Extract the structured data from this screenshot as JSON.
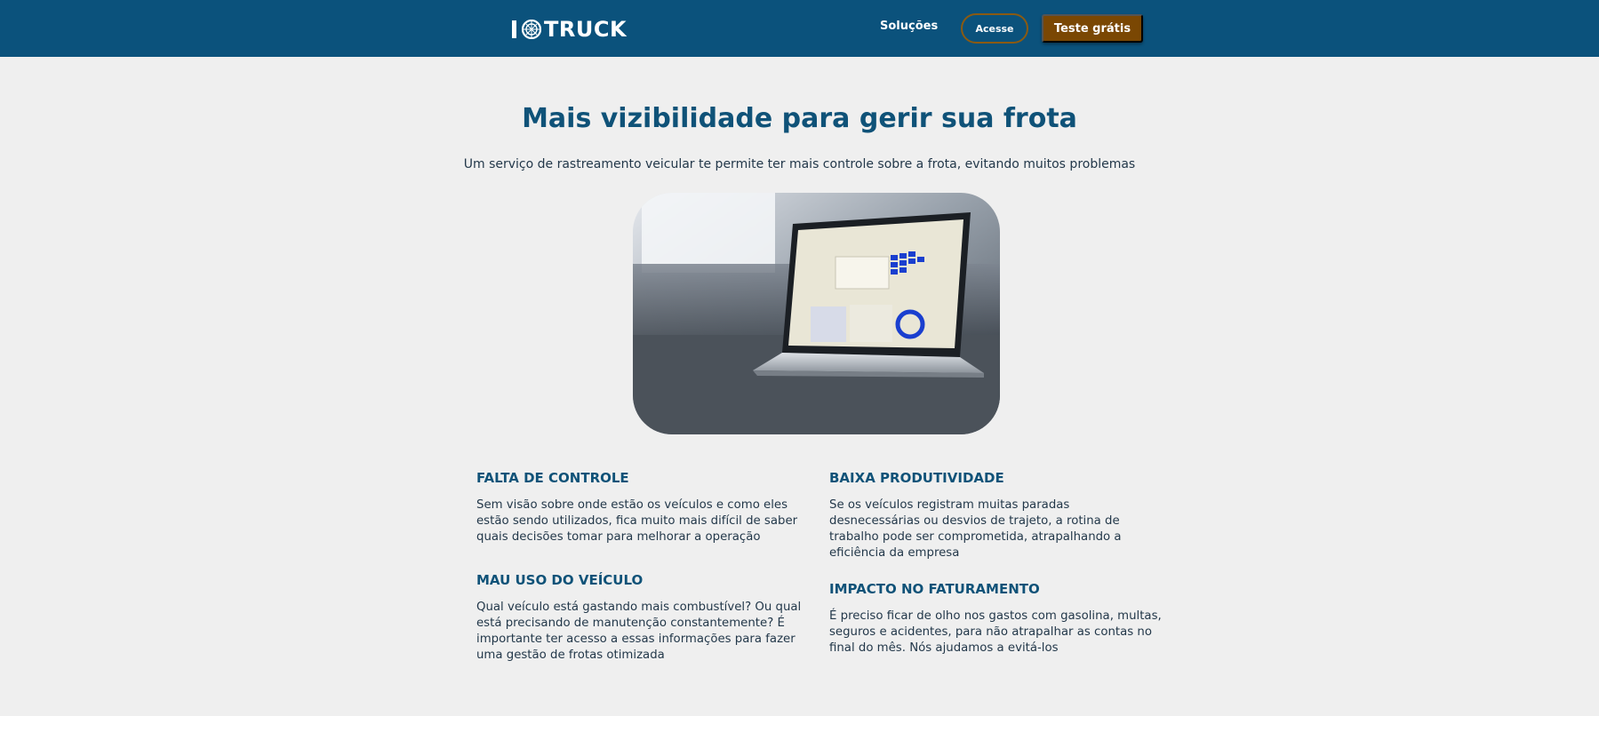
{
  "header": {
    "logo_text": "TRUCK",
    "logo_prefix": "I",
    "nav_solucoes": "Soluções",
    "btn_acesse": "Acesse",
    "btn_teste": "Teste grátis",
    "colors": {
      "bar": "#0b527c",
      "accent": "#7a4703"
    }
  },
  "main": {
    "title": "Mais vizibilidade para gerir sua frota",
    "subtitle": "Um serviço de rastreamento veicular te permite ter mais controle sobre a frota, evitando muitos problemas",
    "hero_image": "laptop-dashboard-photo",
    "features": [
      {
        "heading": "FALTA DE CONTROLE",
        "text": "Sem visão sobre onde estão os veículos e como eles estão sendo utilizados, fica muito mais difícil de saber quais decisões tomar para melhorar a operação"
      },
      {
        "heading": "BAIXA PRODUTIVIDADE",
        "text": "Se os veículos registram muitas paradas desnecessárias ou desvios de trajeto, a rotina de trabalho pode ser comprometida, atrapalhando a eficiência da empresa"
      },
      {
        "heading": "MAU USO DO VEÍCULO",
        "text": "Qual veículo está gastando mais combustível? Ou qual está precisando de manutenção constantemente? É importante ter acesso a essas informações para fazer uma gestão de frotas otimizada"
      },
      {
        "heading": "IMPACTO NO FATURAMENTO",
        "text": "É preciso ficar de olho nos gastos com gasolina, multas, seguros e acidentes, para não atrapalhar as contas no final do mês. Nós ajudamos a evitá-los"
      }
    ]
  }
}
